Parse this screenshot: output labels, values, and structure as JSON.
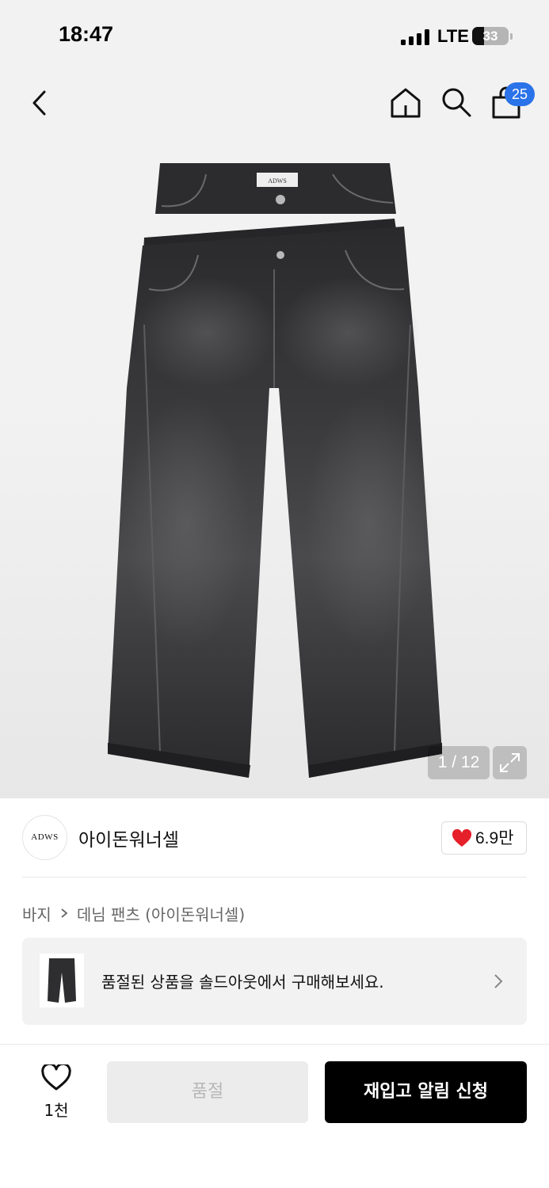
{
  "status_bar": {
    "time": "18:47",
    "network": "LTE",
    "battery": "33",
    "battery_level": 0.33
  },
  "nav": {
    "back_icon": "chevron-left-icon",
    "home_icon": "home-icon",
    "search_icon": "search-icon",
    "bag_icon": "shopping-bag-icon",
    "cart_count": "25",
    "badge_color": "#2a73e8"
  },
  "gallery": {
    "counter": "1 / 12",
    "expand_icon": "expand-icon"
  },
  "brand": {
    "logo_text": "ADWS",
    "name": "아이돈워너셀",
    "likes": "6.9만",
    "heart_color": "#e5202a"
  },
  "breadcrumb": {
    "category": "바지",
    "subcategory": "데님 팬츠 (아이돈워너셀)"
  },
  "soldout_banner": {
    "text": "품절된 상품을 솔드아웃에서 구매해보세요."
  },
  "bottom_bar": {
    "wish_count": "1천",
    "soldout_label": "품절",
    "restock_label": "재입고 알림 신청"
  }
}
